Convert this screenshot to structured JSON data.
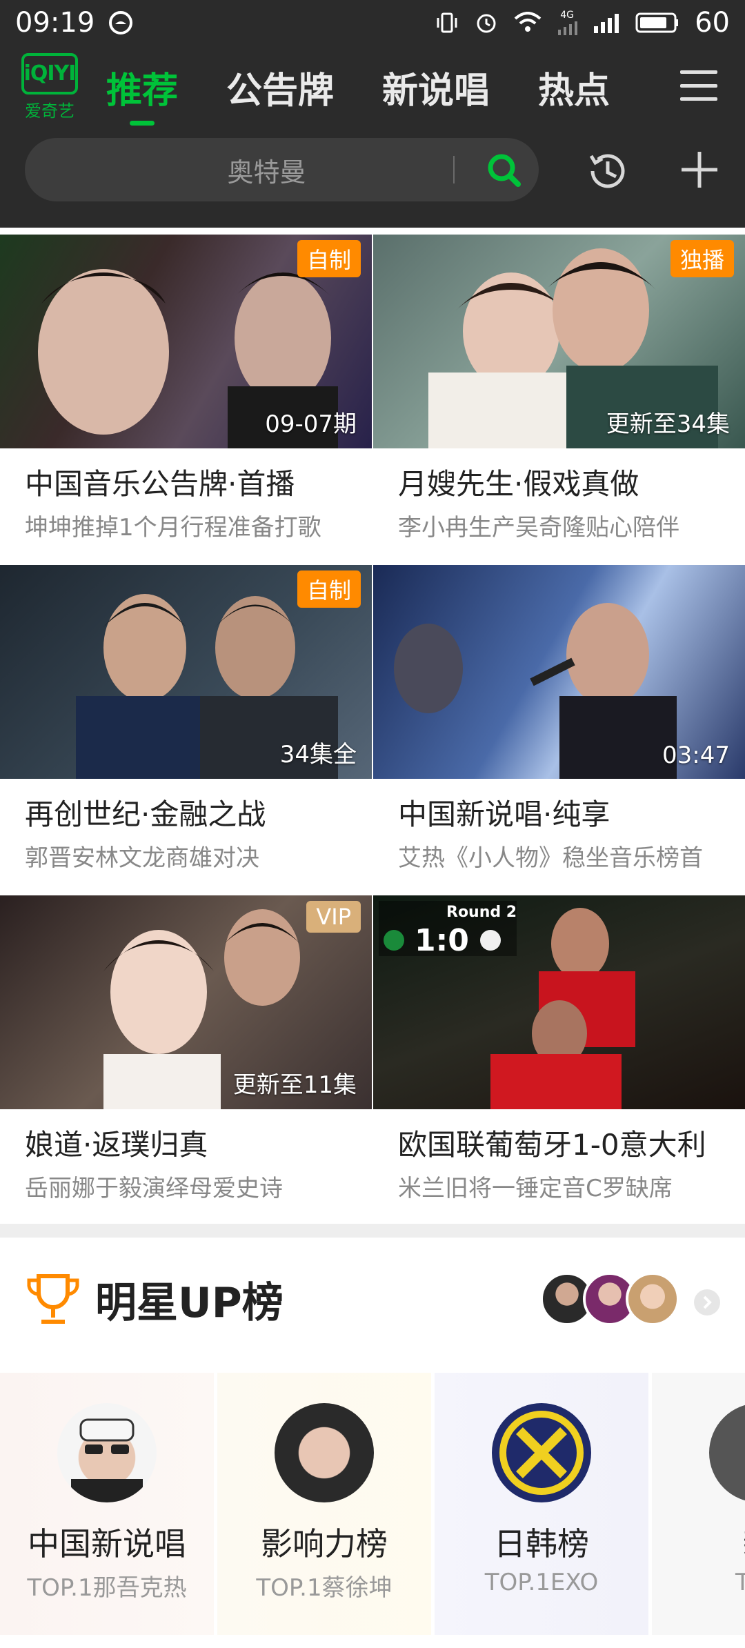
{
  "status_bar": {
    "time": "09:19",
    "battery": "60",
    "network": "4G"
  },
  "nav": {
    "logo_text": "iQIYI",
    "logo_sub": "爱奇艺",
    "tabs": [
      {
        "label": "推荐",
        "active": true
      },
      {
        "label": "公告牌",
        "active": false
      },
      {
        "label": "新说唱",
        "active": false
      },
      {
        "label": "热点",
        "active": false
      }
    ]
  },
  "search": {
    "placeholder": "奥特曼"
  },
  "cards": [
    {
      "badge": "自制",
      "overlay": "09-07期",
      "title": "中国音乐公告牌·首播",
      "subtitle": "坤坤推掉1个月行程准备打歌"
    },
    {
      "badge": "独播",
      "overlay": "更新至34集",
      "title": "月嫂先生·假戏真做",
      "subtitle": "李小冉生产吴奇隆贴心陪伴"
    },
    {
      "badge": "自制",
      "overlay": "34集全",
      "title": "再创世纪·金融之战",
      "subtitle": "郭晋安林文龙商雄对决"
    },
    {
      "badge": "",
      "overlay": "03:47",
      "title": "中国新说唱·纯享",
      "subtitle": "艾热《小人物》稳坐音乐榜首"
    },
    {
      "badge": "VIP",
      "overlay": "更新至11集",
      "title": "娘道·返璞归真",
      "subtitle": "岳丽娜于毅演绎母爱史诗"
    },
    {
      "badge": "",
      "overlay": "",
      "title": "欧国联葡萄牙1-0意大利",
      "subtitle": "米兰旧将一锤定音C罗缺席",
      "score_label": "Round 2",
      "score": "1:0"
    }
  ],
  "up_section": {
    "title": "明星UP榜"
  },
  "rankings": [
    {
      "name": "中国新说唱",
      "top": "TOP.1那吾克热"
    },
    {
      "name": "影响力榜",
      "top": "TOP.1蔡徐坤"
    },
    {
      "name": "日韩榜",
      "top": "TOP.1EXO"
    },
    {
      "name": "新",
      "top": "TOP"
    }
  ],
  "colors": {
    "accent": "#00c339",
    "header_bg": "#2b2b2b",
    "badge_orange": "#ff8a00",
    "badge_vip": "#d9b07a"
  }
}
